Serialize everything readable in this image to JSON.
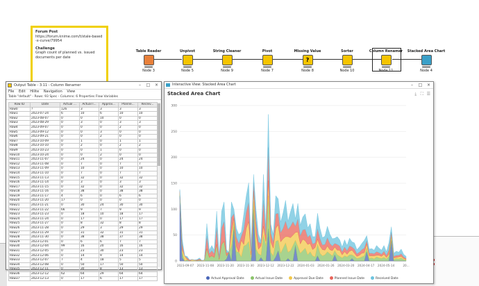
{
  "note": {
    "title": "Forum Post",
    "url": "https://forum.knime.com/t/stale-based-x-curve/79954",
    "challenge_title": "Challenge",
    "challenge_text": "Graph count of planned vs. issued documents per date"
  },
  "workflow": {
    "nodes": [
      {
        "label": "Table Reader",
        "number": "Node 3",
        "color": "#e8803a"
      },
      {
        "label": "Unpivot",
        "number": "Node 5",
        "color": "#f5c400"
      },
      {
        "label": "String Cleaner",
        "number": "Node 9",
        "color": "#f5c400"
      },
      {
        "label": "Pivot",
        "number": "Node 7",
        "color": "#f5c400"
      },
      {
        "label": "Missing Value",
        "number": "Node 8",
        "color": "#f5c400"
      },
      {
        "label": "Sorter",
        "number": "Node 10",
        "color": "#f5c400"
      },
      {
        "label": "Column Renamer",
        "number": "Node 11",
        "color": "#f5c400"
      },
      {
        "label": "Stacked Area Chart",
        "number": "Node 4",
        "color": "#3aa0c8"
      }
    ]
  },
  "output_window": {
    "title": "Output Table - 3:11 - Column Renamer",
    "menu": [
      "File",
      "Edit",
      "Hilite",
      "Navigation",
      "View"
    ],
    "tabs": "Table \"default\" - Rows: 93   Spec - Columns: 6   Properties   Flow Variables",
    "columns": [
      "Row ID",
      "Date",
      "Actual ...",
      "Actual I...",
      "Approv...",
      "Planne...",
      "Receiv..."
    ],
    "rows": [
      [
        "Row0",
        "?",
        "126",
        "3",
        "3",
        "3",
        "3"
      ],
      [
        "Row1",
        "2023-07-24",
        "6",
        "10",
        "6",
        "10",
        "10"
      ],
      [
        "Row2",
        "2023-08-07",
        "0",
        "0",
        "10",
        "0",
        "0"
      ],
      [
        "Row3",
        "2023-08-29",
        "0",
        "3",
        "0",
        "3",
        "3"
      ],
      [
        "Row4",
        "2023-09-07",
        "0",
        "0",
        "0",
        "2",
        "0"
      ],
      [
        "Row5",
        "2023-09-12",
        "0",
        "0",
        "3",
        "0",
        "0"
      ],
      [
        "Row6",
        "2023-09-21",
        "0",
        "0",
        "2",
        "0",
        "0"
      ],
      [
        "Row7",
        "2023-10-09",
        "0",
        "1",
        "0",
        "1",
        "1"
      ],
      [
        "Row8",
        "2023-10-10",
        "0",
        "2",
        "0",
        "2",
        "2"
      ],
      [
        "Row9",
        "2023-10-23",
        "0",
        "0",
        "1",
        "0",
        "0"
      ],
      [
        "Row10",
        "2023-10-24",
        "0",
        "0",
        "2",
        "0",
        "0"
      ],
      [
        "Row11",
        "2023-11-07",
        "0",
        "24",
        "0",
        "24",
        "24"
      ],
      [
        "Row12",
        "2023-11-08",
        "0",
        "7",
        "0",
        "7",
        "7"
      ],
      [
        "Row13",
        "2023-11-09",
        "0",
        "10",
        "0",
        "10",
        "10"
      ],
      [
        "Row14",
        "2023-11-10",
        "0",
        "7",
        "0",
        "7",
        "7"
      ],
      [
        "Row15",
        "2023-11-13",
        "0",
        "32",
        "0",
        "32",
        "32"
      ],
      [
        "Row16",
        "2023-11-14",
        "0",
        "3",
        "0",
        "3",
        "3"
      ],
      [
        "Row17",
        "2023-11-15",
        "0",
        "32",
        "0",
        "32",
        "32"
      ],
      [
        "Row18",
        "2023-11-16",
        "0",
        "38",
        "0",
        "38",
        "38"
      ],
      [
        "Row19",
        "2023-11-17",
        "4",
        "6",
        "0",
        "6",
        "6"
      ],
      [
        "Row20",
        "2023-11-20",
        "17",
        "0",
        "0",
        "0",
        "0"
      ],
      [
        "Row21",
        "2023-11-21",
        "0",
        "30",
        "24",
        "30",
        "30"
      ],
      [
        "Row22",
        "2023-11-22",
        "66",
        "9",
        "7",
        "9",
        "9"
      ],
      [
        "Row23",
        "2023-11-23",
        "0",
        "18",
        "10",
        "18",
        "17"
      ],
      [
        "Row24",
        "2023-11-24",
        "0",
        "17",
        "0",
        "17",
        "17"
      ],
      [
        "Row25",
        "2023-11-27",
        "0",
        "8",
        "32",
        "8",
        "8"
      ],
      [
        "Row26",
        "2023-11-28",
        "0",
        "29",
        "3",
        "29",
        "29"
      ],
      [
        "Row27",
        "2023-11-29",
        "0",
        "31",
        "32",
        "31",
        "31"
      ],
      [
        "Row28",
        "2023-11-30",
        "0",
        "38",
        "38",
        "37",
        "38"
      ],
      [
        "Row29",
        "2023-12-01",
        "0",
        "6",
        "6",
        "7",
        "7"
      ],
      [
        "Row30",
        "2023-12-04",
        "99",
        "16",
        "20",
        "16",
        "16"
      ],
      [
        "Row31",
        "2023-12-05",
        "0",
        "23",
        "30",
        "23",
        "23"
      ],
      [
        "Row32",
        "2023-12-06",
        "0",
        "14",
        "9",
        "14",
        "14"
      ],
      [
        "Row33",
        "2023-12-07",
        "7",
        "4",
        "18",
        "5",
        "5"
      ],
      [
        "Row34",
        "2023-12-08",
        "0",
        "50",
        "17",
        "50",
        "50"
      ],
      [
        "Row35",
        "2023-12-11",
        "0",
        "30",
        "8",
        "13",
        "13"
      ],
      [
        "Row36",
        "2023-12-12",
        "62",
        "64",
        "29",
        "64",
        "64"
      ],
      [
        "Row37",
        "2023-12-13",
        "0",
        "17",
        "6",
        "17",
        "17"
      ]
    ]
  },
  "chart_window": {
    "title": "Interactive View: Stacked Area Chart",
    "chart_title": "Stacked Area Chart"
  },
  "chart_data": {
    "type": "area",
    "title": "Stacked Area Chart",
    "ylim": [
      0,
      300
    ],
    "y_ticks": [
      "300",
      "250",
      "200",
      "150",
      "100",
      "50",
      "0"
    ],
    "x_ticks": [
      "2023-09-07",
      "2023-11-08",
      "2023-11-20",
      "2023-11-30",
      "2023-12-12",
      "2023-12-22",
      "2024-01-03",
      "2024-01-26",
      "2024-03-20",
      "2024-04-17",
      "2024-05-14",
      "20..."
    ],
    "series": [
      {
        "name": "Actual Approval Date",
        "color": "#4a66b8"
      },
      {
        "name": "Actual Issue Date",
        "color": "#8bc46a"
      },
      {
        "name": "Approval Due Date",
        "color": "#f2c74a"
      },
      {
        "name": "Planned Issue Date",
        "color": "#e8645a"
      },
      {
        "name": "Received Date",
        "color": "#6cc3de"
      }
    ],
    "values": {
      "Actual Approval Date": [
        126,
        6,
        0,
        0,
        0,
        0,
        0,
        0,
        0,
        0,
        0,
        0,
        0,
        0,
        0,
        0,
        0,
        0,
        0,
        4,
        17,
        0,
        66,
        0,
        0,
        0,
        0,
        0,
        0,
        0,
        99,
        0,
        0,
        7,
        0,
        0,
        62,
        0,
        0,
        8,
        20,
        0,
        0,
        0,
        5,
        0,
        0,
        30,
        0,
        0,
        0,
        0,
        0,
        0,
        0,
        0,
        10,
        0,
        0,
        0,
        0,
        0,
        0,
        12,
        0,
        0,
        0,
        0,
        0,
        0,
        5,
        0,
        0,
        0,
        0,
        0,
        18,
        0,
        0,
        0,
        0,
        0,
        0,
        0,
        0,
        0,
        40,
        0,
        0,
        0,
        0,
        0,
        0
      ],
      "Actual Issue Date": [
        3,
        10,
        0,
        3,
        0,
        0,
        0,
        1,
        2,
        0,
        0,
        24,
        7,
        10,
        7,
        32,
        3,
        32,
        38,
        6,
        0,
        30,
        9,
        18,
        17,
        8,
        29,
        31,
        38,
        6,
        16,
        23,
        14,
        4,
        50,
        30,
        64,
        17,
        10,
        30,
        20,
        15,
        25,
        35,
        12,
        20,
        30,
        10,
        28,
        15,
        20,
        25,
        12,
        18,
        10,
        8,
        22,
        15,
        10,
        12,
        18,
        14,
        10,
        8,
        12,
        9,
        6,
        10,
        8,
        12,
        7,
        9,
        5,
        6,
        8,
        10,
        7,
        5,
        6,
        4,
        8,
        6,
        5,
        7,
        4,
        9,
        6,
        3,
        5,
        4,
        6,
        3,
        2
      ],
      "Approval Due Date": [
        3,
        6,
        10,
        0,
        0,
        3,
        2,
        0,
        0,
        1,
        2,
        0,
        0,
        0,
        0,
        0,
        0,
        0,
        0,
        0,
        0,
        24,
        7,
        10,
        0,
        32,
        3,
        32,
        38,
        6,
        20,
        30,
        9,
        18,
        17,
        8,
        29,
        20,
        15,
        25,
        30,
        22,
        18,
        12,
        30,
        25,
        20,
        15,
        28,
        18,
        22,
        14,
        20,
        16,
        12,
        18,
        10,
        14,
        12,
        9,
        11,
        8,
        10,
        7,
        9,
        12,
        6,
        8,
        5,
        7,
        9,
        6,
        4,
        5,
        7,
        6,
        8,
        5,
        4,
        6,
        3,
        5,
        4,
        6,
        3,
        4,
        5,
        3,
        2,
        4,
        3,
        2,
        1
      ],
      "Planned Issue Date": [
        3,
        10,
        0,
        3,
        2,
        0,
        0,
        1,
        2,
        0,
        0,
        24,
        7,
        10,
        7,
        32,
        3,
        32,
        38,
        6,
        0,
        30,
        9,
        18,
        17,
        8,
        29,
        31,
        37,
        7,
        16,
        23,
        14,
        5,
        50,
        13,
        64,
        17,
        12,
        28,
        22,
        18,
        20,
        30,
        14,
        22,
        26,
        12,
        25,
        16,
        18,
        22,
        14,
        16,
        11,
        9,
        20,
        14,
        9,
        11,
        16,
        12,
        9,
        7,
        11,
        8,
        6,
        9,
        7,
        10,
        6,
        8,
        5,
        6,
        7,
        9,
        6,
        5,
        5,
        4,
        7,
        5,
        4,
        6,
        4,
        8,
        5,
        3,
        4,
        3,
        5,
        3,
        2
      ],
      "Received Date": [
        3,
        10,
        0,
        3,
        0,
        0,
        0,
        1,
        2,
        0,
        0,
        24,
        7,
        10,
        7,
        32,
        3,
        32,
        38,
        6,
        0,
        30,
        9,
        17,
        17,
        8,
        29,
        31,
        38,
        7,
        16,
        23,
        14,
        5,
        50,
        13,
        64,
        17,
        14,
        35,
        28,
        20,
        30,
        40,
        15,
        28,
        35,
        14,
        30,
        20,
        25,
        30,
        18,
        22,
        14,
        12,
        30,
        20,
        14,
        16,
        22,
        18,
        14,
        10,
        15,
        12,
        9,
        14,
        10,
        15,
        10,
        12,
        8,
        10,
        12,
        15,
        10,
        8,
        9,
        7,
        12,
        9,
        8,
        11,
        7,
        14,
        10,
        6,
        8,
        6,
        9,
        5,
        4
      ]
    }
  }
}
